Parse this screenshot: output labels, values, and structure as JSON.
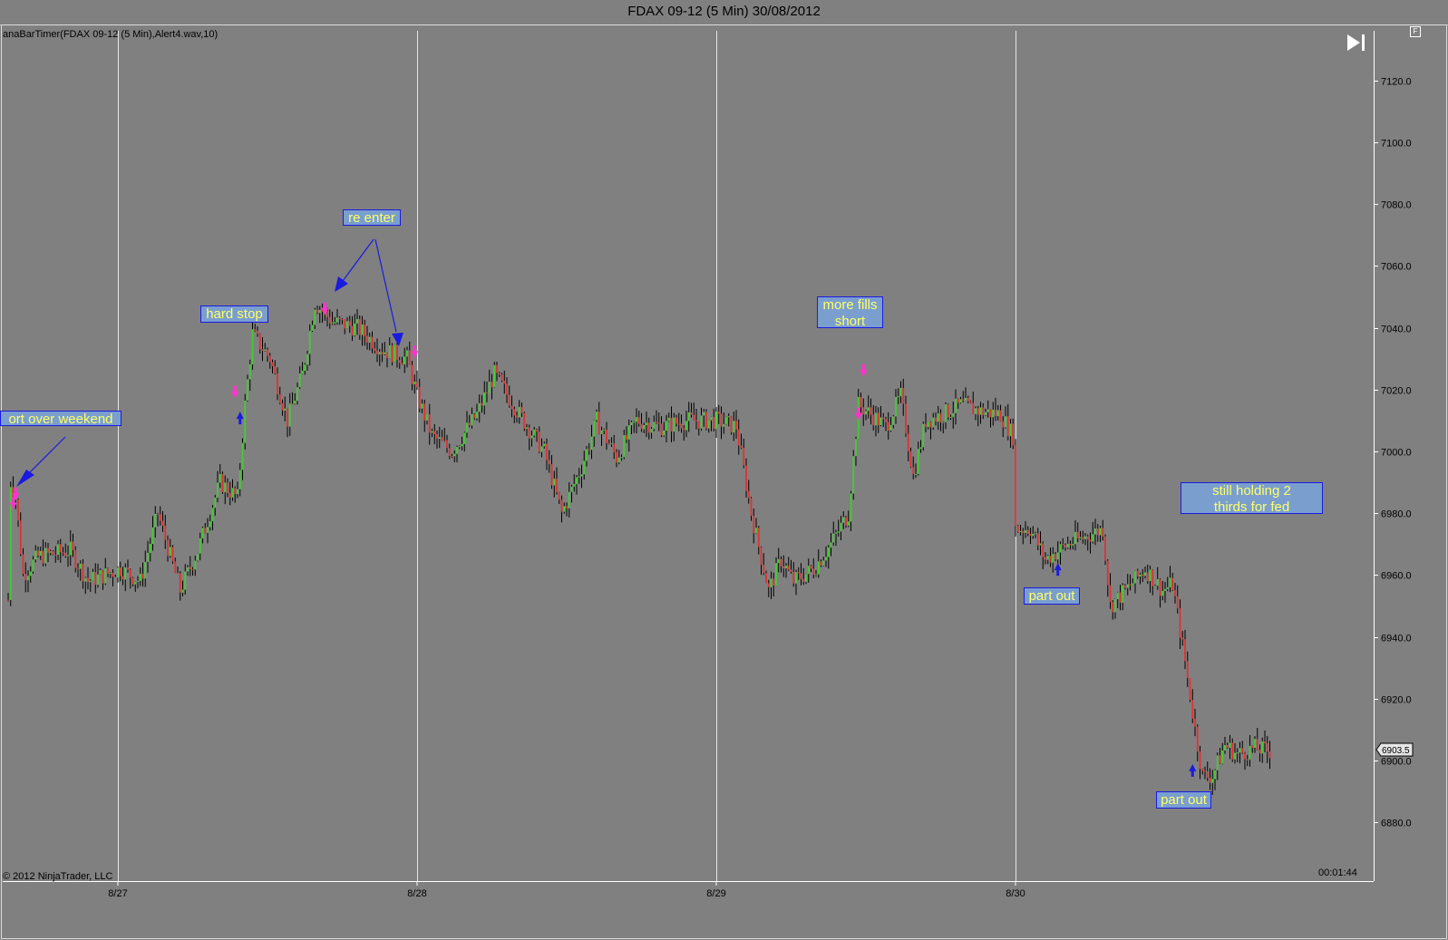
{
  "window": {
    "title": "FDAX 09-12 (5 Min)  30/08/2012"
  },
  "chart": {
    "indicator_label": "anaBarTimer(FDAX 09-12 (5 Min),Alert4.wav,10)",
    "copyright": "© 2012 NinjaTrader, LLC",
    "bar_timer": "00:01:44",
    "float_button": "F",
    "jump_icon": "jump-to-end-icon",
    "price_marker": "6903.5",
    "annotations": [
      {
        "id": "short-over-weekend",
        "text": "ort over weekend"
      },
      {
        "id": "hard-stop",
        "text": "hard stop"
      },
      {
        "id": "re-enter",
        "text": "re enter"
      },
      {
        "id": "more-fills-short",
        "text": "more fills short"
      },
      {
        "id": "still-holding",
        "text": "still holding 2 thirds for fed"
      },
      {
        "id": "part-out-1",
        "text": "part out"
      },
      {
        "id": "part-out-2",
        "text": "part out"
      }
    ],
    "colors": {
      "background": "#808080",
      "up_bar": "#44cc33",
      "down_bar": "#dd3333",
      "wick": "#000000",
      "annotation_fill": "#7a9fcf",
      "annotation_text": "#ffff66",
      "annotation_border": "#1a1ae0",
      "short_marker": "#ff33cc",
      "long_marker": "#1a1ae0"
    }
  },
  "chart_data": {
    "type": "candlestick",
    "title": "FDAX 09-12 (5 Min)  30/08/2012",
    "y_ticks": [
      6880,
      6900,
      6920,
      6940,
      6960,
      6980,
      7000,
      7020,
      7040,
      7060,
      7080,
      7100,
      7120
    ],
    "ylim": [
      6866,
      7136
    ],
    "x_ticks": [
      "8/27",
      "8/28",
      "8/29",
      "8/30"
    ],
    "x_tick_index": [
      44,
      164,
      284,
      404
    ],
    "bars_total": 512,
    "last_price": 6903.5,
    "grid": "vertical day separators",
    "price_path": [
      [
        0,
        6952
      ],
      [
        1,
        6990
      ],
      [
        3,
        6985
      ],
      [
        6,
        6960
      ],
      [
        12,
        6966
      ],
      [
        25,
        6968
      ],
      [
        32,
        6958
      ],
      [
        45,
        6962
      ],
      [
        53,
        6958
      ],
      [
        60,
        6980
      ],
      [
        69,
        6955
      ],
      [
        76,
        6968
      ],
      [
        85,
        6990
      ],
      [
        92,
        6985
      ],
      [
        95,
        7015
      ],
      [
        98,
        7038
      ],
      [
        105,
        7030
      ],
      [
        112,
        7010
      ],
      [
        118,
        7025
      ],
      [
        123,
        7048
      ],
      [
        130,
        7042
      ],
      [
        140,
        7040
      ],
      [
        150,
        7033
      ],
      [
        160,
        7030
      ],
      [
        164,
        7018
      ],
      [
        170,
        7005
      ],
      [
        178,
        7000
      ],
      [
        188,
        7012
      ],
      [
        195,
        7025
      ],
      [
        205,
        7012
      ],
      [
        215,
        7000
      ],
      [
        222,
        6980
      ],
      [
        230,
        6995
      ],
      [
        236,
        7010
      ],
      [
        244,
        6998
      ],
      [
        252,
        7010
      ],
      [
        262,
        7008
      ],
      [
        272,
        7010
      ],
      [
        284,
        7010
      ],
      [
        292,
        7008
      ],
      [
        298,
        6980
      ],
      [
        305,
        6955
      ],
      [
        310,
        6965
      ],
      [
        315,
        6958
      ],
      [
        323,
        6962
      ],
      [
        330,
        6970
      ],
      [
        337,
        6980
      ],
      [
        341,
        7015
      ],
      [
        346,
        7012
      ],
      [
        352,
        7008
      ],
      [
        358,
        7018
      ],
      [
        363,
        6992
      ],
      [
        368,
        7010
      ],
      [
        375,
        7012
      ],
      [
        382,
        7015
      ],
      [
        390,
        7013
      ],
      [
        398,
        7012
      ],
      [
        403,
        7005
      ],
      [
        404,
        6975
      ],
      [
        410,
        6975
      ],
      [
        416,
        6965
      ],
      [
        425,
        6970
      ],
      [
        431,
        6972
      ],
      [
        439,
        6975
      ],
      [
        442,
        6950
      ],
      [
        448,
        6955
      ],
      [
        456,
        6962
      ],
      [
        463,
        6955
      ],
      [
        467,
        6957
      ],
      [
        472,
        6932
      ],
      [
        476,
        6910
      ],
      [
        479,
        6895
      ],
      [
        483,
        6895
      ],
      [
        488,
        6905
      ],
      [
        493,
        6902
      ],
      [
        500,
        6904
      ],
      [
        506,
        6903
      ]
    ],
    "signals": [
      {
        "type": "short",
        "bar": 3,
        "price": 6985
      },
      {
        "type": "short",
        "bar": 2,
        "price": 6982
      },
      {
        "type": "long",
        "bar": 93,
        "price": 7012
      },
      {
        "type": "short",
        "bar": 91,
        "price": 7018
      },
      {
        "type": "short",
        "bar": 127,
        "price": 7045
      },
      {
        "type": "short",
        "bar": 163,
        "price": 7031
      },
      {
        "type": "short",
        "bar": 343,
        "price": 7025
      },
      {
        "type": "short",
        "bar": 341,
        "price": 7011
      },
      {
        "type": "long",
        "bar": 421,
        "price": 6963
      },
      {
        "type": "long",
        "bar": 475,
        "price": 6898
      }
    ]
  }
}
